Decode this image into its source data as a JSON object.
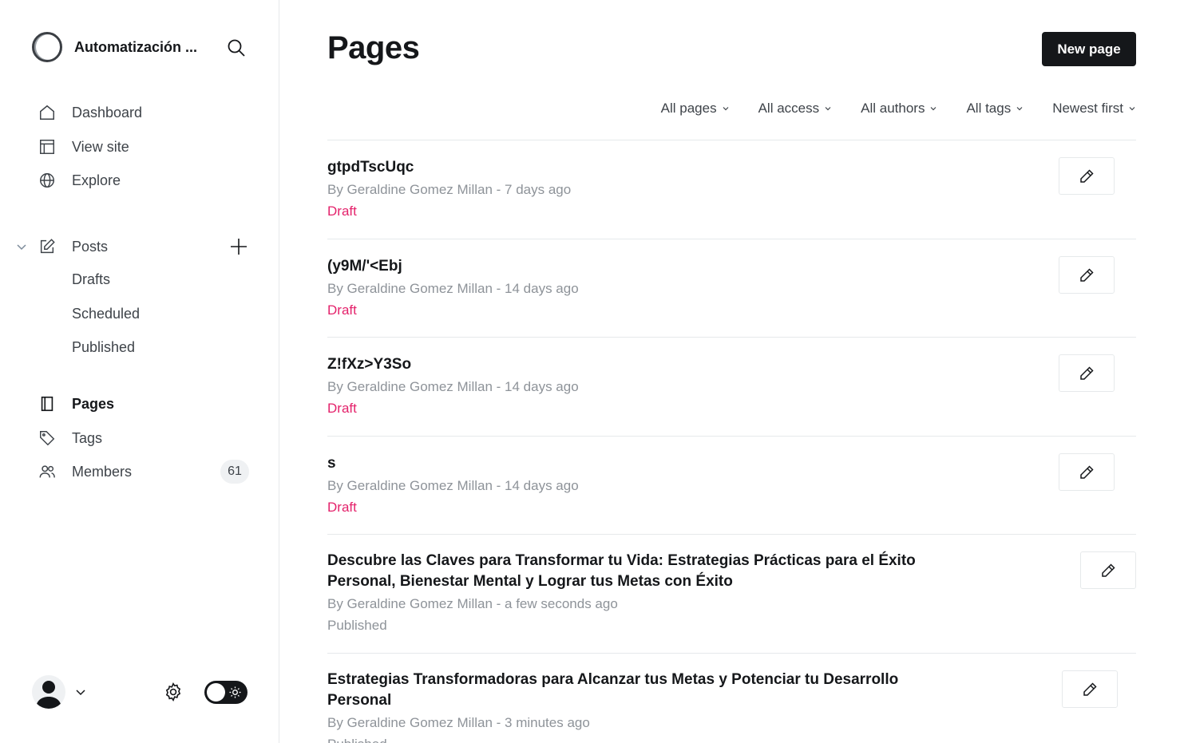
{
  "sidebar": {
    "site_name": "Automatización ...",
    "nav": {
      "dashboard": "Dashboard",
      "view_site": "View site",
      "explore": "Explore",
      "posts": "Posts",
      "drafts": "Drafts",
      "scheduled": "Scheduled",
      "published": "Published",
      "pages": "Pages",
      "tags": "Tags",
      "members": "Members",
      "members_count": "61"
    }
  },
  "main": {
    "title": "Pages",
    "new_page_label": "New page",
    "filters": {
      "type": "All pages",
      "access": "All access",
      "authors": "All authors",
      "tags": "All tags",
      "order": "Newest first"
    },
    "rows": [
      {
        "title": "gtpdTscUqc",
        "meta": "By Geraldine Gomez Millan - 7 days ago",
        "status": "Draft"
      },
      {
        "title": "(y9M/'<Ebj",
        "meta": "By Geraldine Gomez Millan - 14 days ago",
        "status": "Draft"
      },
      {
        "title": "Z!fXz>Y3So",
        "meta": "By Geraldine Gomez Millan - 14 days ago",
        "status": "Draft"
      },
      {
        "title": "s",
        "meta": "By Geraldine Gomez Millan - 14 days ago",
        "status": "Draft"
      },
      {
        "title": "Descubre las Claves para Transformar tu Vida: Estrategias Prácticas para el Éxito Personal, Bienestar Mental y Lograr tus Metas con Éxito",
        "meta": "By Geraldine Gomez Millan - a few seconds ago",
        "status": "Published"
      },
      {
        "title": "Estrategias Transformadoras para Alcanzar tus Metas y Potenciar tu Desarrollo Personal",
        "meta": "By Geraldine Gomez Millan - 3 minutes ago",
        "status": "Published"
      }
    ]
  },
  "colors": {
    "accent_draft": "#e4226b",
    "primary_button": "#15171a",
    "muted_text": "#8e9399"
  },
  "icons": {
    "logo": "ghost-ring-logo",
    "search": "search-icon",
    "dashboard": "home-icon",
    "view_site": "layout-icon",
    "explore": "globe-icon",
    "posts": "edit-square-icon",
    "pages": "page-icon",
    "tags": "tag-icon",
    "members": "members-icon",
    "edit": "pencil-icon",
    "settings": "gear-icon",
    "theme": "sun-icon"
  }
}
